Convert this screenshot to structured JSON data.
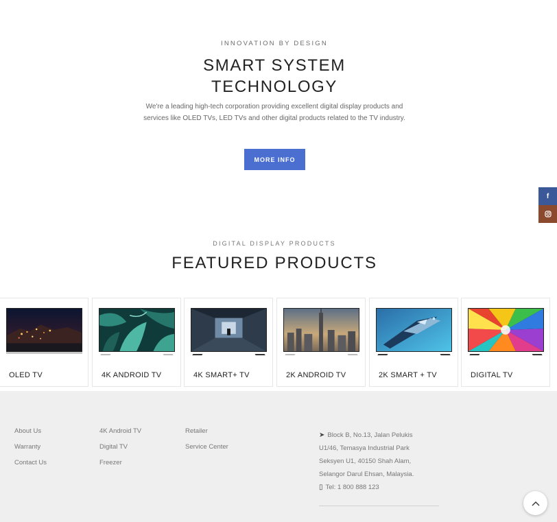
{
  "hero": {
    "kicker": "INNOVATION BY DESIGN",
    "title_line1": "SMART SYSTEM",
    "title_line2": "TECHNOLOGY",
    "description": "We're a leading high-tech corporation providing excellent digital display products and services like OLED TVs, LED TVs and other digital products related to the TV industry.",
    "button_label": "MORE INFO",
    "button_color": "#4a6fd1"
  },
  "social": {
    "facebook_icon": "facebook-icon",
    "facebook_glyph": "f",
    "instagram_icon": "instagram-icon",
    "facebook_color": "#3b5998",
    "instagram_color": "#8b4a2e"
  },
  "featured": {
    "kicker": "DIGITAL DISPLAY PRODUCTS",
    "title": "FEATURED PRODUCTS",
    "products": [
      {
        "label": "OLED TV",
        "image": "night-city-coastline"
      },
      {
        "label": "4K ANDROID TV",
        "image": "tropical-leaves"
      },
      {
        "label": "4K SMART+ TV",
        "image": "sci-fi-corridor"
      },
      {
        "label": "2K ANDROID TV",
        "image": "city-skyline"
      },
      {
        "label": "2K SMART + TV",
        "image": "spaceship"
      },
      {
        "label": "DIGITAL TV",
        "image": "color-burst"
      }
    ]
  },
  "footer": {
    "col1": [
      "About Us",
      "Warranty",
      "Contact Us"
    ],
    "col2": [
      "4K Android TV",
      "Digital TV",
      "Freezer"
    ],
    "col3": [
      "Retailer",
      "Service Center"
    ],
    "address_lines": [
      "Block B, No.13, Jalan Pelukis",
      "U1/46, Temasya Industrial Park",
      "Seksyen U1, 40150 Shah Alam,",
      "Selangor Darul Ehsan, Malaysia."
    ],
    "phone": "Tel: 1 800 888 123",
    "back_to_top_icon": "chevron-up-icon"
  }
}
